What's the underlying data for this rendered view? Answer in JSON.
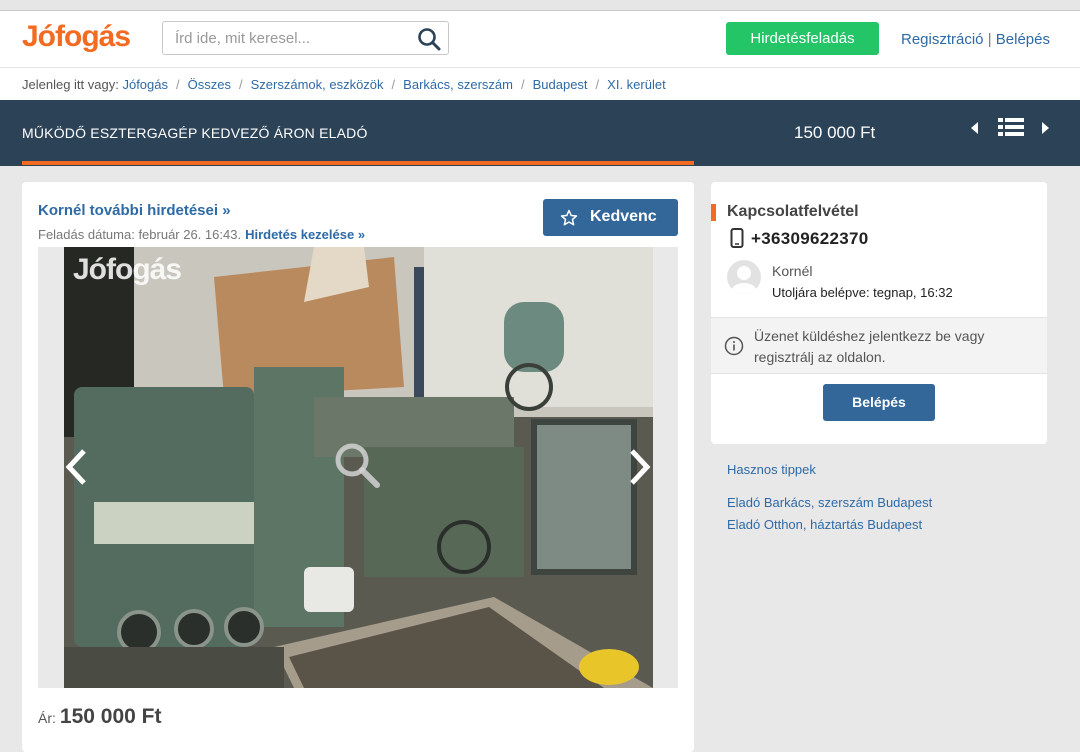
{
  "header": {
    "logo": "Jófogás",
    "search_placeholder": "Írd ide, mit keresel...",
    "post_button": "Hirdetésfeladás",
    "register": "Regisztráció",
    "separator": "|",
    "login": "Belépés"
  },
  "breadcrumb": {
    "prefix": "Jelenleg itt vagy:",
    "items": [
      "Jófogás",
      "Összes",
      "Szerszámok, eszközök",
      "Barkács, szerszám",
      "Budapest",
      "XI. kerület"
    ]
  },
  "listing": {
    "title": "MŰKÖDŐ ESZTERGAGÉP KEDVEZŐ ÁRON ELADÓ",
    "price_header": "150 000 Ft",
    "more_ads": "Kornél további hirdetései »",
    "date_label": "Feladás dátuma: február 26. 16:43.",
    "manage_link": "Hirdetés kezelése »",
    "favorite_button": "Kedvenc",
    "watermark": "Jófogás",
    "price_label": "Ár:",
    "price": "150 000 Ft"
  },
  "contact": {
    "heading": "Kapcsolatfelvétel",
    "phone": "+36309622370",
    "name": "Kornél",
    "last_login": "Utoljára belépve: tegnap, 16:32",
    "notice": "Üzenet küldéshez jelentkezz be vagy regisztrálj az oldalon.",
    "login_button": "Belépés"
  },
  "side_links": {
    "tips": "Hasznos tippek",
    "link1": "Eladó Barkács, szerszám Budapest",
    "link2": "Eladó Otthon, háztartás Budapest"
  },
  "colors": {
    "brand_orange": "#f26b21",
    "post_green": "#23c567",
    "nav_blue": "#2b4257",
    "button_blue": "#336699",
    "link_blue": "#2e6aa6"
  },
  "icons": [
    "search-icon",
    "prev-arrow-icon",
    "list-view-icon",
    "next-arrow-icon",
    "star-icon",
    "phone-icon",
    "info-icon",
    "magnifier-icon",
    "chevron-left-icon",
    "chevron-right-icon",
    "avatar-placeholder-icon"
  ]
}
